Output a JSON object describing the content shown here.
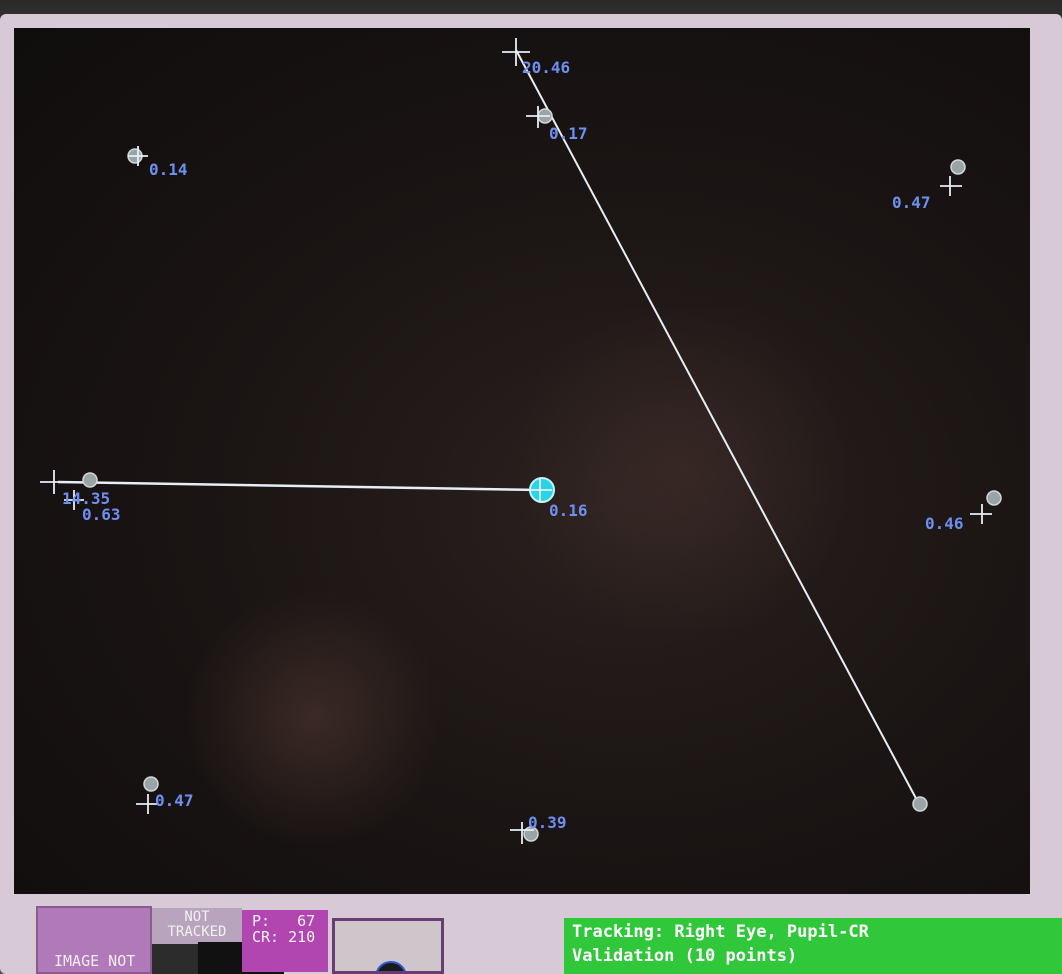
{
  "validation_points": [
    {
      "label": "0.14"
    },
    {
      "label": "0.17"
    },
    {
      "label": "20.46"
    },
    {
      "label": "0.47"
    },
    {
      "label": "14.35"
    },
    {
      "label": "0.63"
    },
    {
      "label": "0.16"
    },
    {
      "label": "0.46"
    },
    {
      "label": "0.47"
    },
    {
      "label": "0.39"
    }
  ],
  "status": {
    "image_not": "IMAGE NOT",
    "not_tracked_line1": "NOT",
    "not_tracked_line2": "TRACKED",
    "p_label": "P:",
    "p_value": "67",
    "cr_label": "CR:",
    "cr_value": "210",
    "tracking_line": "Tracking:  Right Eye, Pupil-CR",
    "validation_line": "Validation (10 points)"
  },
  "colors": {
    "label_blue": "#6f8ff0",
    "trace_white": "#e8eef5",
    "status_green": "#30c83a",
    "pcr_magenta": "#b146b0",
    "active_target_cyan": "#2ad4e8"
  }
}
